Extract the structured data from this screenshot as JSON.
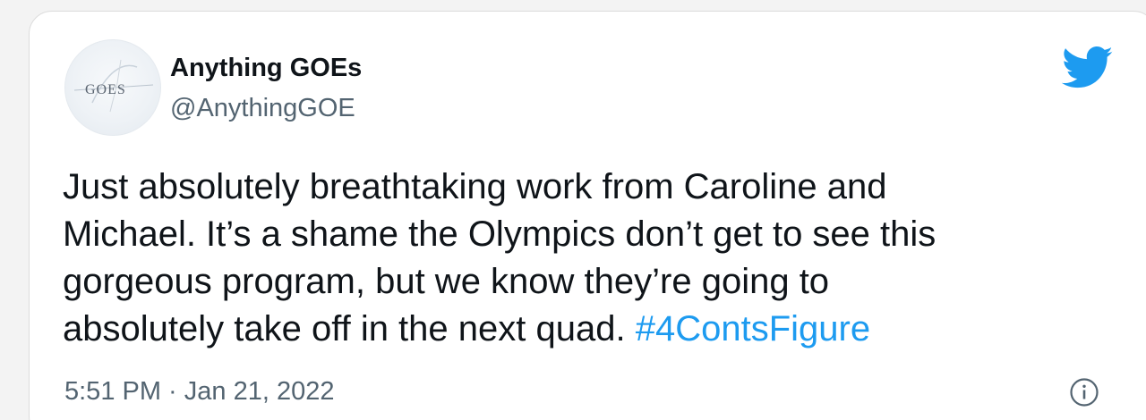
{
  "author": {
    "display_name": "Anything GOEs",
    "handle": "@AnythingGOE",
    "avatar_text": "GOES"
  },
  "tweet": {
    "text_line_1": "Just absolutely breathtaking work from Caroline and",
    "text_line_2": "Michael. It’s a shame the Olympics don’t get to see this",
    "text_line_3": "gorgeous program, but we know they’re going to",
    "text_line_4": "absolutely take off in the next quad. ",
    "hashtag": "#4ContsFigure",
    "timestamp": "5:51 PM · Jan 21, 2022"
  },
  "icons": {
    "brand": "twitter-bird-icon",
    "info": "info-icon"
  },
  "colors": {
    "brand_blue": "#1d9bf0",
    "text_primary": "#0f1419",
    "text_secondary": "#536471"
  }
}
